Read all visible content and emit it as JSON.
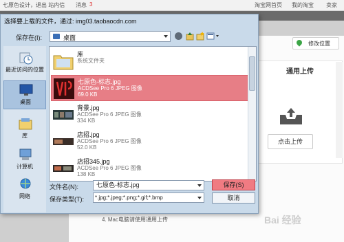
{
  "topbar": {
    "left_text": "七原色设计，退出  站内信",
    "message": "消息",
    "message_count": "3",
    "shop_home": "淘宝网首页",
    "my_taobao": "我的淘宝",
    "buyer": "卖家"
  },
  "webpage": {
    "location_button": "修改位置",
    "upload_title": "通用上传",
    "upload_button": "点击上传",
    "hint": "4. Mac电脑请使用通用上传",
    "watermark": "Bai 经验"
  },
  "dialog": {
    "title": "选择要上载的文件，通过: img03.taobaocdn.com",
    "save_in_label": "保存在(I):",
    "save_in_value": "桌面",
    "places": [
      {
        "label": "最近访问的位置",
        "icon": "clock-icon"
      },
      {
        "label": "桌面",
        "icon": "desktop-icon"
      },
      {
        "label": "库",
        "icon": "library-icon"
      },
      {
        "label": "计算机",
        "icon": "computer-icon"
      },
      {
        "label": "网络",
        "icon": "network-icon"
      }
    ],
    "files": [
      {
        "name": "库",
        "type": "系统文件夹",
        "size": "",
        "icon": "folder-icon"
      },
      {
        "name": "七原色-标志.jpg",
        "type": "ACDSee Pro 6 JPEG 图像",
        "size": "69.0 KB",
        "icon": "image-thumb"
      },
      {
        "name": "背景.jpg",
        "type": "ACDSee Pro 6 JPEG 图像",
        "size": "334 KB",
        "icon": "image-thumb"
      },
      {
        "name": "店招.jpg",
        "type": "ACDSee Pro 6 JPEG 图像",
        "size": "52.0 KB",
        "icon": "image-thumb"
      },
      {
        "name": "店招345.jpg",
        "type": "ACDSee Pro 6 JPEG 图像",
        "size": "138 KB",
        "icon": "image-thumb"
      }
    ],
    "selected_file_index": 1,
    "filename_label": "文件名(N):",
    "filename_value": "七原色-标志.jpg",
    "filetype_label": "保存类型(T):",
    "filetype_value": "*.jpg;*.jpeg;*.png;*.gif;*.bmp",
    "save_button": "保存(S)",
    "cancel_button": "取消"
  },
  "colors": {
    "selection": "#e77e86",
    "dialog_bg": "#c9daea",
    "save_button": "#f07b82"
  }
}
